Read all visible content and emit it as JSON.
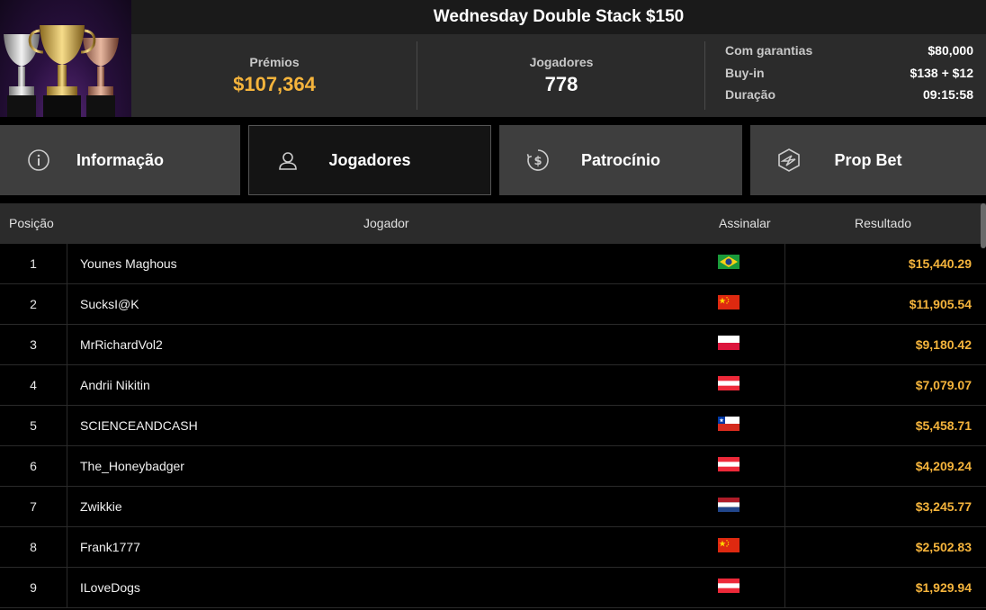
{
  "tournament": {
    "title": "Wednesday Double Stack $150",
    "prize_label": "Prémios",
    "prize_value": "$107,364",
    "players_label": "Jogadores",
    "players_value": "778",
    "info": [
      {
        "key": "Com garantias",
        "value": "$80,000"
      },
      {
        "key": "Buy-in",
        "value": "$138 + $12"
      },
      {
        "key": "Duração",
        "value": "09:15:58"
      }
    ]
  },
  "tabs": [
    {
      "label": "Informação",
      "icon": "info-icon",
      "active": false
    },
    {
      "label": "Jogadores",
      "icon": "user-icon",
      "active": true
    },
    {
      "label": "Patrocínio",
      "icon": "dollar-coin-icon",
      "active": false
    },
    {
      "label": "Prop Bet",
      "icon": "lightning-hex-icon",
      "active": false
    }
  ],
  "table": {
    "headers": {
      "position": "Posição",
      "player": "Jogador",
      "flag": "Assinalar",
      "result": "Resultado"
    },
    "rows": [
      {
        "pos": "1",
        "name": "Younes Maghous",
        "flag": "brazil",
        "result": "$15,440.29"
      },
      {
        "pos": "2",
        "name": "SucksI@K",
        "flag": "china",
        "result": "$11,905.54"
      },
      {
        "pos": "3",
        "name": "MrRichardVol2",
        "flag": "poland",
        "result": "$9,180.42"
      },
      {
        "pos": "4",
        "name": "Andrii Nikitin",
        "flag": "austria",
        "result": "$7,079.07"
      },
      {
        "pos": "5",
        "name": "SCIENCEANDCASH",
        "flag": "chile",
        "result": "$5,458.71"
      },
      {
        "pos": "6",
        "name": "The_Honeybadger",
        "flag": "austria",
        "result": "$4,209.24"
      },
      {
        "pos": "7",
        "name": "Zwikkie",
        "flag": "netherlands",
        "result": "$3,245.77"
      },
      {
        "pos": "8",
        "name": "Frank1777",
        "flag": "china",
        "result": "$2,502.83"
      },
      {
        "pos": "9",
        "name": "ILoveDogs",
        "flag": "austria",
        "result": "$1,929.94"
      }
    ]
  },
  "colors": {
    "gold": "#f5b43c",
    "header_bg": "#2b2b2b",
    "tab_bg": "#3e3e3e"
  }
}
